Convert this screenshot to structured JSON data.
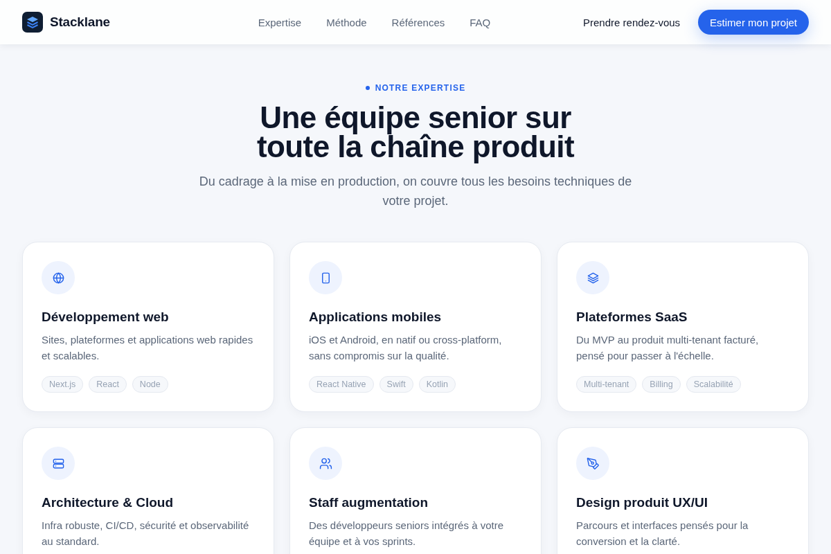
{
  "header": {
    "brand": "Stacklane",
    "nav": [
      "Expertise",
      "Méthode",
      "Références",
      "FAQ"
    ],
    "secondary_link": "Prendre rendez-vous",
    "cta_button": "Estimer mon projet"
  },
  "hero": {
    "eyebrow": "NOTRE EXPERTISE",
    "title": "Une équipe senior sur toute la chaîne produit",
    "subtitle": "Du cadrage à la mise en production, on couvre tous les besoins techniques de votre projet."
  },
  "services": [
    {
      "title": "Développement web",
      "description": "Sites, plateformes et applications web rapides et scalables.",
      "tags": [
        "Next.js",
        "React",
        "Node"
      ]
    },
    {
      "title": "Applications mobiles",
      "description": "iOS et Android, en natif ou cross-platform, sans compromis sur la qualité.",
      "tags": [
        "React Native",
        "Swift",
        "Kotlin"
      ]
    },
    {
      "title": "Plateformes SaaS",
      "description": "Du MVP au produit multi-tenant facturé, pensé pour passer à l'échelle.",
      "tags": [
        "Multi-tenant",
        "Billing",
        "Scalabilité"
      ]
    },
    {
      "title": "Architecture & Cloud",
      "description": "Infra robuste, CI/CD, sécurité et observabilité au standard."
    },
    {
      "title": "Staff augmentation",
      "description": "Des développeurs seniors intégrés à votre équipe et à vos sprints."
    },
    {
      "title": "Design produit UX/UI",
      "description": "Parcours et interfaces pensés pour la conversion et la clarté."
    }
  ]
}
